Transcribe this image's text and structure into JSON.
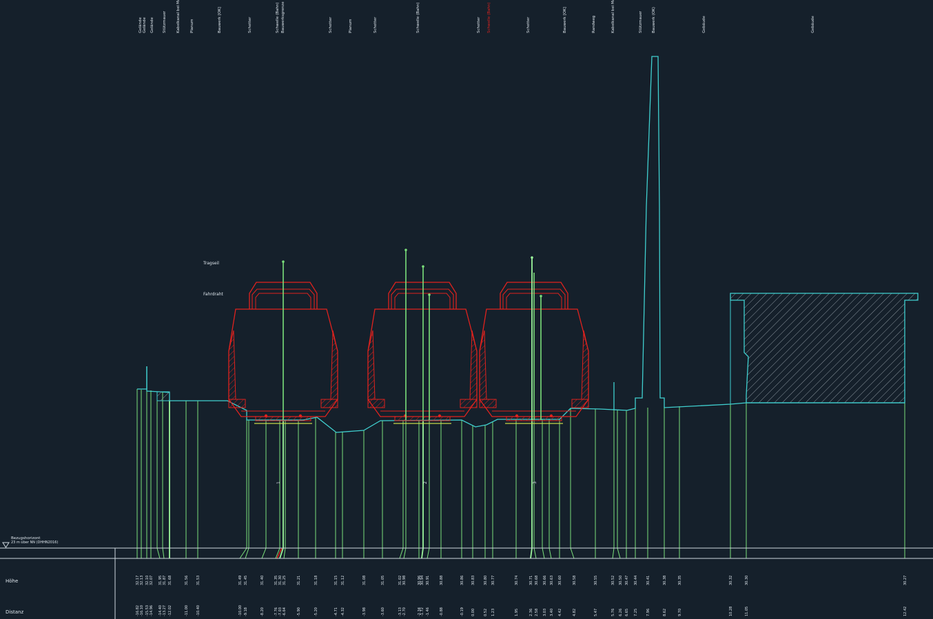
{
  "colors": {
    "background": "#15202b",
    "terrain": "#40d0d0",
    "vertical": "#7be07b",
    "vertical_bright": "#9cf59c",
    "train": "#e0221e",
    "text": "#dfe7ee",
    "frame": "#cfd8df"
  },
  "top_labels": [
    "Gelände",
    "Gelände",
    "Gelände",
    "Stützmauer",
    "Kabelkanal bei Mast",
    "Planum",
    "Bauwerk [OK]",
    "Schotter",
    "Schwelle (Bahn)",
    "Bauwerksgrenze",
    "Schotter",
    "Planum",
    "Schotter",
    "Schwelle (Bahn)",
    "Schotter",
    "Schwelle (Bahn)",
    "Schotter",
    "Bauwerk [OK]",
    "Randweg",
    "Kabelkanal bei Mast",
    "Stützmauer",
    "Bauwerk (OK)",
    "Gebäude"
  ],
  "top_label_highlight": "Schwelle (Bahn)",
  "side_labels": {
    "tragseil": "Tragseil",
    "fahrdraht": "Fahrdraht"
  },
  "track_labels": [
    "1",
    "2",
    "3"
  ],
  "datum": {
    "label": "Bezugshorizont",
    "sublabel": "23 m über NN (DHHN2016)"
  },
  "table": {
    "rows": [
      {
        "label": "Höhe"
      },
      {
        "label": "Distanz"
      }
    ],
    "hoehe_values": [
      "32.17",
      "32.13",
      "32.10",
      "32.07",
      "31.95",
      "31.87",
      "31.68",
      "31.56",
      "31.53",
      "31.49",
      "31.45",
      "31.40",
      "31.35",
      "31.30",
      "31.25",
      "31.21",
      "31.18",
      "31.15",
      "31.12",
      "31.08",
      "31.05",
      "31.02",
      "30.98",
      "30.96",
      "30.94",
      "30.91",
      "30.88",
      "30.86",
      "30.83",
      "30.80",
      "30.77",
      "30.74",
      "30.71",
      "30.68",
      "30.66",
      "30.63",
      "30.60",
      "30.58",
      "30.55",
      "30.52",
      "30.50",
      "30.47",
      "30.44",
      "30.41",
      "30.38",
      "30.35",
      "30.32",
      "30.30",
      "30.27",
      "30.24",
      "30.21",
      "30.18"
    ],
    "distanz_values": [
      "-16.82",
      "-16.10",
      "-15.53",
      "-14.96",
      "-14.40",
      "-13.27",
      "-12.02",
      "-11.00",
      "-10.40",
      "-10.00",
      "-9.18",
      "-8.20",
      "-7.76",
      "-7.03",
      "-6.64",
      "-5.90",
      "-5.20",
      "-4.71",
      "-4.32",
      "-3.98",
      "-3.60",
      "-3.13",
      "-2.70",
      "-2.34",
      "-1.72",
      "-1.46",
      "-0.88",
      "-0.19",
      "0.00",
      "0.52",
      "1.23",
      "1.95",
      "2.36",
      "2.58",
      "3.03",
      "3.40",
      "4.42",
      "4.82",
      "5.47",
      "5.76",
      "6.26",
      "6.65",
      "7.25",
      "7.96",
      "8.62",
      "9.70",
      "10.28",
      "11.05",
      "12.42",
      "13.70",
      "14.83",
      "16.80"
    ]
  }
}
